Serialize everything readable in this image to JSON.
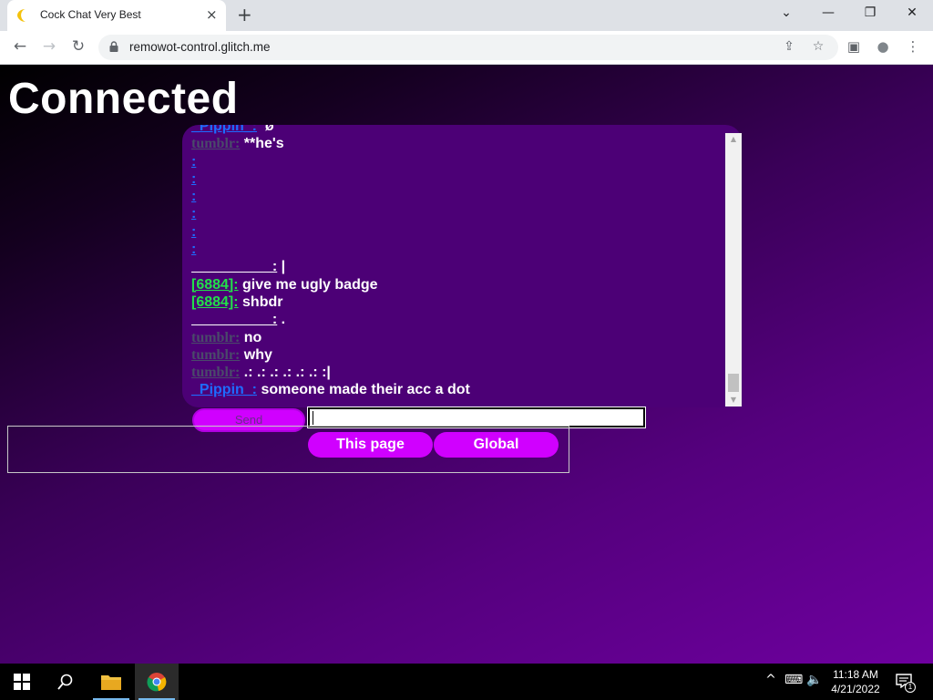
{
  "browser": {
    "tab_title": "Cock Chat Very Best",
    "tab_close_icon": "×",
    "new_tab_icon": "+",
    "url": "remowot-control.glitch.me",
    "window_controls": {
      "tablist": "⌄",
      "minimize": "—",
      "restore": "❐",
      "close": "✕"
    },
    "nav": {
      "back": "←",
      "forward": "→",
      "reload": "↻"
    },
    "omnibox_icons": {
      "share": "⇪",
      "bookmark": "☆"
    },
    "toolbar_icons": {
      "sidepanel": "▣",
      "profile": "●",
      "menu": "⋮"
    }
  },
  "page": {
    "status": "Connected",
    "messages": [
      {
        "user": "_Pippin_:",
        "user_style": "blue",
        "text": "  ø"
      },
      {
        "user": "tumblr:",
        "user_style": "gray",
        "text": " **he's"
      },
      {
        "user": ":",
        "user_style": "blue",
        "text": ""
      },
      {
        "user": ":",
        "user_style": "blue",
        "text": ""
      },
      {
        "user": ":",
        "user_style": "blue",
        "text": ""
      },
      {
        "user": ":",
        "user_style": "blue",
        "text": ""
      },
      {
        "user": ":",
        "user_style": "blue",
        "text": ""
      },
      {
        "user": ":",
        "user_style": "blue",
        "text": ""
      },
      {
        "user": "                    :",
        "user_style": "blank",
        "text": " |"
      },
      {
        "user": "[6884]:",
        "user_style": "green",
        "text": " give me ugly badge"
      },
      {
        "user": "[6884]:",
        "user_style": "green",
        "text": " shbdr"
      },
      {
        "user": "                    :",
        "user_style": "blank",
        "text": " ."
      },
      {
        "user": "tumblr:",
        "user_style": "gray",
        "text": " no"
      },
      {
        "user": "tumblr:",
        "user_style": "gray",
        "text": " why"
      },
      {
        "user": "tumblr:",
        "user_style": "gray",
        "text": " .: .: .: .: .: .: :|"
      },
      {
        "user": "_Pippin_:",
        "user_style": "blue",
        "text": " someone made their acc a dot"
      }
    ],
    "send_label": "Send",
    "message_input_value": "",
    "scope_buttons": [
      "This page",
      "Global"
    ],
    "colors": {
      "accent": "#d000ff",
      "chat_bg": "#4c0076"
    }
  },
  "taskbar": {
    "time": "11:18 AM",
    "date": "4/21/2022",
    "notification_count": "1",
    "tray_icons": {
      "chevron": "^",
      "network": "⌨",
      "volume": "🔈"
    }
  }
}
